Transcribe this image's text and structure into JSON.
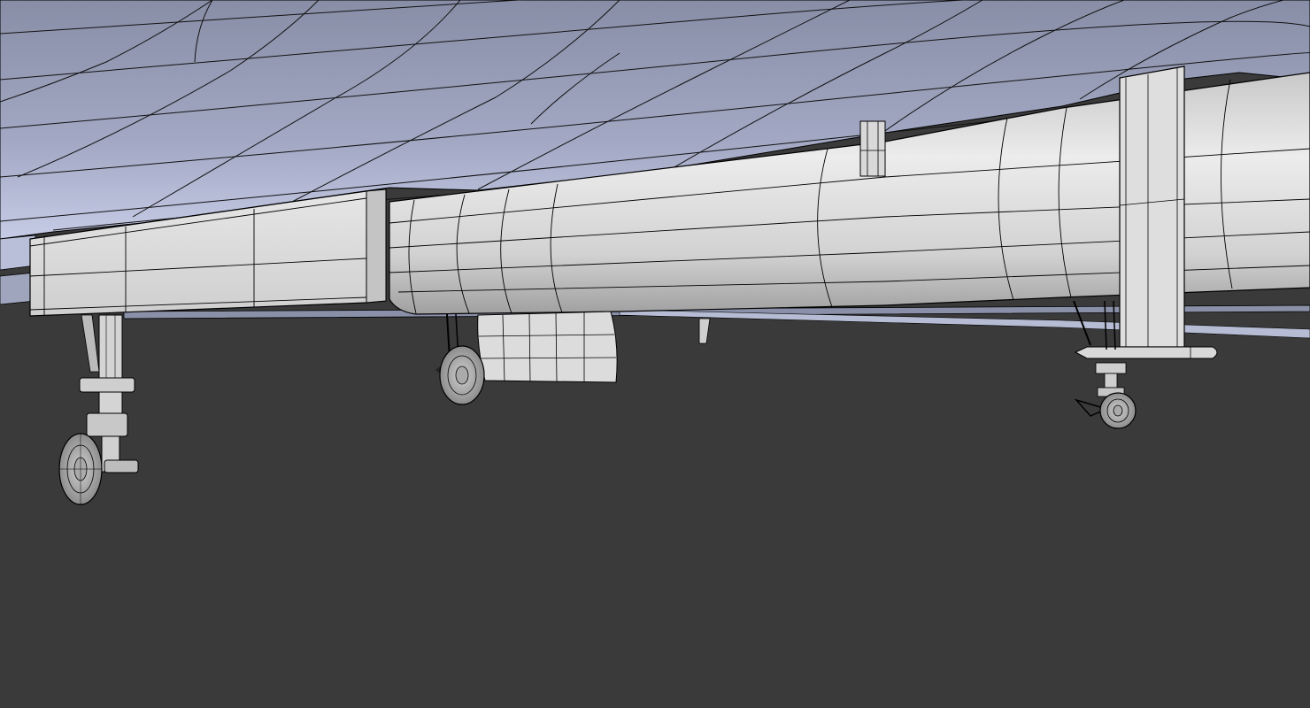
{
  "viewport": {
    "mode": "wireframe-on-shaded",
    "background_color": "#3a3a3a",
    "surface_color": "#a7adc7",
    "fuselage_color": "#d6d6d6",
    "wire_color": "#000000",
    "visible_text": []
  },
  "model": {
    "parts": [
      {
        "name": "wing-underside"
      },
      {
        "name": "nose-box-section"
      },
      {
        "name": "fuselage-cylinder"
      },
      {
        "name": "vertical-strut"
      },
      {
        "name": "small-antenna-fin"
      },
      {
        "name": "nose-landing-gear"
      },
      {
        "name": "middle-landing-gear"
      },
      {
        "name": "rear-landing-gear"
      },
      {
        "name": "gear-door-panel"
      },
      {
        "name": "rear-pitot-tube"
      }
    ]
  }
}
